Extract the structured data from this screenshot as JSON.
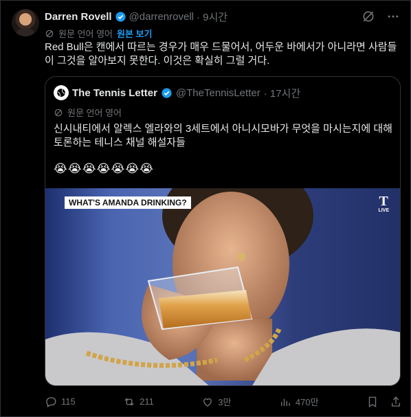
{
  "author": {
    "name": "Darren Rovell",
    "handle": "@darrenrovell",
    "time": "· 9시간"
  },
  "translation": {
    "label": "원문 언어 영어",
    "show_original": "원본 보기"
  },
  "tweet_text": "Red Bull은 캔에서 따르는 경우가 매우 드물어서, 어두운 바에서가 아니라면 사람들이 그것을 알아보지 못한다. 이것은 확실히 그럴 거다.",
  "quote": {
    "name": "The Tennis Letter",
    "handle": "@TheTennisLetter",
    "time": "· 17시간",
    "translation_label": "원문 언어 영어",
    "text": "신시내티에서 알렉스 엘라와의 3세트에서 아니시모바가 무엇을 마시는지에 대해 토론하는 테니스 채널 해설자들",
    "emoji": "😭😭😭😭😭😭😭",
    "media_caption": "WHAT'S AMANDA DRINKING?",
    "channel_logo": "T",
    "channel_live": "LIVE"
  },
  "actions": {
    "replies": "115",
    "reposts": "211",
    "likes": "3만",
    "views": "470만"
  },
  "colors": {
    "accent": "#1d9bf0",
    "text": "#e7e9ea",
    "muted": "#71767b",
    "border": "#2f3336"
  }
}
